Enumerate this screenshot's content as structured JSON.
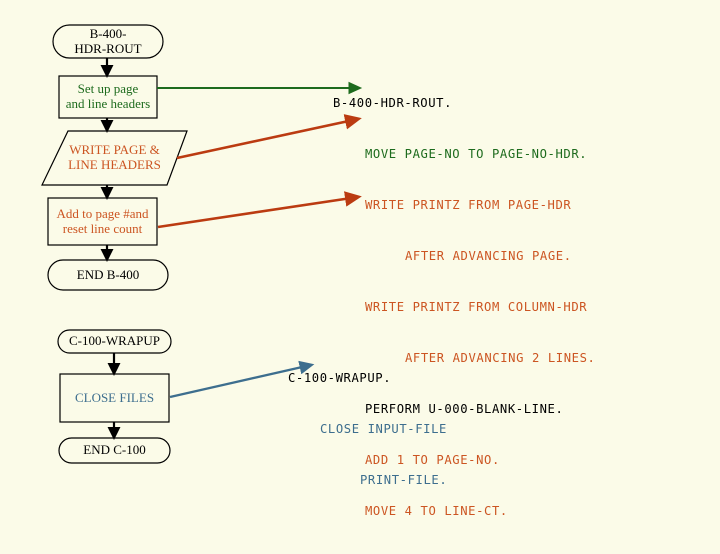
{
  "page": {
    "background_color": "#fbfbe8",
    "title": "COBOL paragraph flowchart — B-400-HDR-ROUT and C-100-WRAPUP"
  },
  "colors": {
    "background": "#fbfbe8",
    "outline": "#000000",
    "green": "#1d6b1d",
    "orange": "#cc5522",
    "red_arrow": "#bb3b11",
    "blue": "#3d6e8e",
    "black": "#000000"
  },
  "flowchart_b400": {
    "nodes": [
      {
        "name": "start-terminator-b400",
        "shape": "terminator",
        "lines": [
          "B-400-",
          "HDR-ROUT"
        ],
        "text_color": "#000000"
      },
      {
        "name": "process-setup-headers",
        "shape": "rectangle",
        "lines": [
          "Set up page",
          "and line headers"
        ],
        "text_color": "#1d6b1d"
      },
      {
        "name": "io-write-page-line-headers",
        "shape": "parallelogram",
        "lines": [
          "WRITE PAGE &",
          "LINE HEADERS"
        ],
        "text_color": "#cc5522"
      },
      {
        "name": "process-add-page-reset-line",
        "shape": "rectangle",
        "lines": [
          "Add to page #and",
          "reset line count"
        ],
        "text_color": "#cc5522"
      },
      {
        "name": "end-terminator-b400",
        "shape": "terminator",
        "lines": [
          "END B-400"
        ],
        "text_color": "#000000"
      }
    ]
  },
  "flowchart_c100": {
    "nodes": [
      {
        "name": "start-terminator-c100",
        "shape": "terminator",
        "lines": [
          "C-100-WRAPUP"
        ],
        "text_color": "#000000"
      },
      {
        "name": "process-close-files",
        "shape": "rectangle",
        "lines": [
          "CLOSE FILES"
        ],
        "text_color": "#3d6e8e"
      },
      {
        "name": "end-terminator-c100",
        "shape": "terminator",
        "lines": [
          "END C-100"
        ],
        "text_color": "#000000"
      }
    ]
  },
  "code_b400": {
    "name": "code-block-b400",
    "lines": [
      {
        "text": "B-400-HDR-ROUT.",
        "color": "#000000",
        "indent": 0
      },
      {
        "text": "MOVE PAGE-NO TO PAGE-NO-HDR.",
        "color": "#1d6b1d",
        "indent": 1
      },
      {
        "text": "WRITE PRINTZ FROM PAGE-HDR",
        "color": "#cc5522",
        "indent": 1
      },
      {
        "text": "AFTER ADVANCING PAGE.",
        "color": "#cc5522",
        "indent": 2
      },
      {
        "text": "WRITE PRINTZ FROM COLUMN-HDR",
        "color": "#cc5522",
        "indent": 1
      },
      {
        "text": "AFTER ADVANCING 2 LINES.",
        "color": "#cc5522",
        "indent": 2
      },
      {
        "text": "PERFORM U-000-BLANK-LINE.",
        "color": "#000000",
        "indent": 1
      },
      {
        "text": "ADD 1 TO PAGE-NO.",
        "color": "#cc5522",
        "indent": 1
      },
      {
        "text": "MOVE 4 TO LINE-CT.",
        "color": "#cc5522",
        "indent": 1
      }
    ]
  },
  "code_c100": {
    "name": "code-block-c100",
    "lines": [
      {
        "text": "C-100-WRAPUP.",
        "color": "#000000",
        "indent": 0
      },
      {
        "text": "CLOSE INPUT-FILE",
        "color": "#3d6e8e",
        "indent": 1
      },
      {
        "text": "PRINT-FILE.",
        "color": "#3d6e8e",
        "indent": 2
      }
    ]
  },
  "connectors": {
    "flow_arrows": [
      {
        "name": "flow-arrow-start-to-setup",
        "color": "#000000"
      },
      {
        "name": "flow-arrow-setup-to-write",
        "color": "#000000"
      },
      {
        "name": "flow-arrow-write-to-add",
        "color": "#000000"
      },
      {
        "name": "flow-arrow-add-to-end",
        "color": "#000000"
      },
      {
        "name": "flow-arrow-c100-start-to-close",
        "color": "#000000"
      },
      {
        "name": "flow-arrow-close-to-end",
        "color": "#000000"
      }
    ],
    "mapping_arrows": [
      {
        "name": "map-arrow-setup-to-move-page-no",
        "color": "#1d6b1d"
      },
      {
        "name": "map-arrow-write-to-write-printz",
        "color": "#bb3b11"
      },
      {
        "name": "map-arrow-add-to-add-1",
        "color": "#bb3b11"
      },
      {
        "name": "map-arrow-close-to-close-input",
        "color": "#3d6e8e"
      }
    ]
  }
}
